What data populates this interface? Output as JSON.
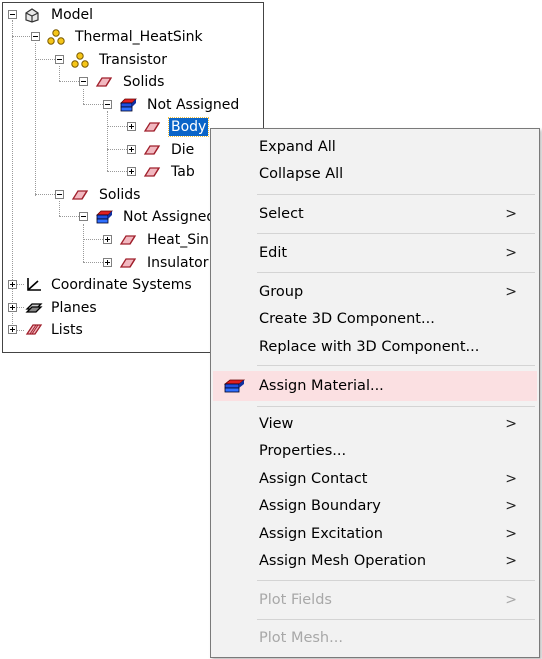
{
  "tree": {
    "model": "Model",
    "thermal_heatsink": "Thermal_HeatSink",
    "transistor": "Transistor",
    "solids_1": "Solids",
    "not_assigned_1": "Not Assigned",
    "body": "Body",
    "die": "Die",
    "tab": "Tab",
    "solids_2": "Solids",
    "not_assigned_2": "Not Assigned",
    "heat_sink": "Heat_Sink",
    "insulator": "Insulator",
    "coordinate_systems": "Coordinate Systems",
    "planes": "Planes",
    "lists": "Lists"
  },
  "context_menu": {
    "expand_all": "Expand All",
    "collapse_all": "Collapse All",
    "select": "Select",
    "edit": "Edit",
    "group": "Group",
    "create_3d_component": "Create 3D Component...",
    "replace_with_3d_component": "Replace with 3D Component...",
    "assign_material": "Assign Material...",
    "view": "View",
    "properties": "Properties...",
    "assign_contact": "Assign Contact",
    "assign_boundary": "Assign Boundary",
    "assign_excitation": "Assign Excitation",
    "assign_mesh_operation": "Assign Mesh Operation",
    "plot_fields": "Plot Fields",
    "plot_mesh": "Plot Mesh...",
    "submenu_arrow": ">"
  },
  "colors": {
    "selection": "#0a64c8",
    "menu_highlight": "#fbe0e2",
    "menu_background": "#f2f2f2",
    "disabled_text": "#a8a8a8"
  }
}
